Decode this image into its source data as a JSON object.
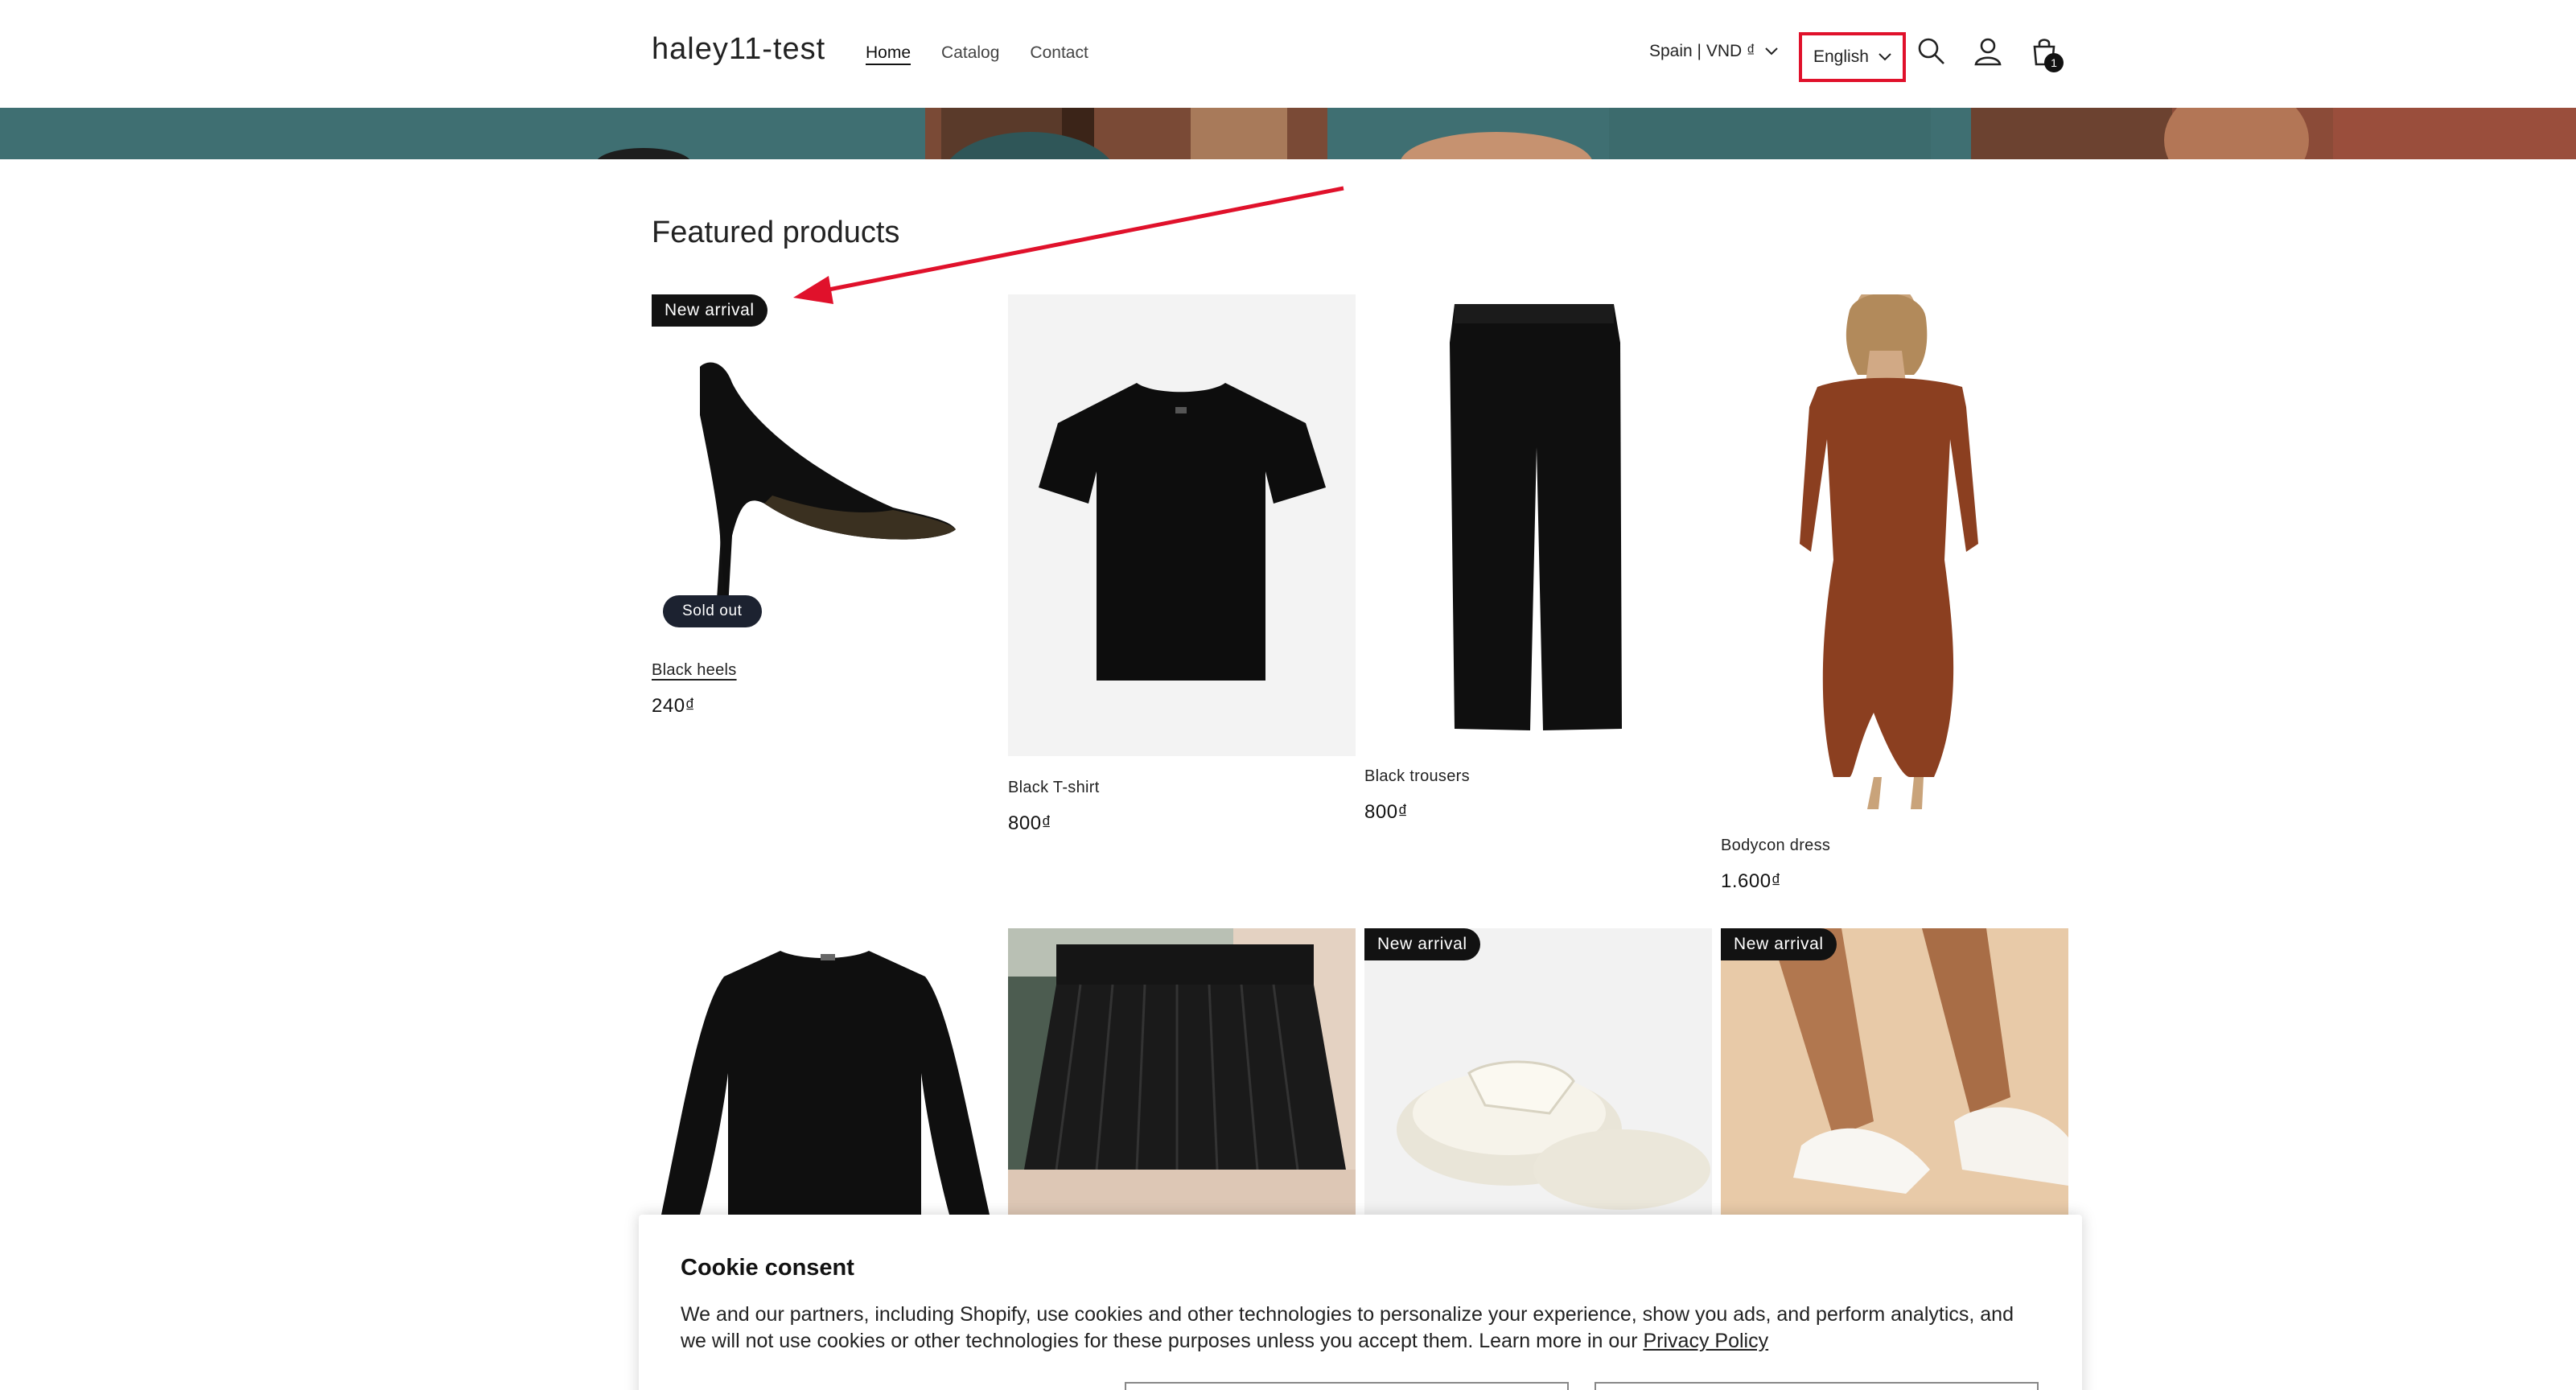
{
  "header": {
    "logo": "haley11-test",
    "nav": [
      {
        "label": "Home",
        "active": true
      },
      {
        "label": "Catalog",
        "active": false
      },
      {
        "label": "Contact",
        "active": false
      }
    ],
    "country_selector": "Spain | VND ₫",
    "language_selector": "English",
    "icons": [
      "search-icon",
      "account-icon",
      "cart-icon"
    ],
    "cart_count": "1",
    "highlight_color": "#e0112b"
  },
  "section": {
    "title": "Featured products"
  },
  "products": [
    {
      "title": "Black heels",
      "price": "240₫",
      "badge": "New arrival",
      "status_badge": "Sold out"
    },
    {
      "title": "Black T-shirt",
      "price": "800₫"
    },
    {
      "title": "Black trousers",
      "price": "800₫"
    },
    {
      "title": "Bodycon dress",
      "price": "1.600₫"
    },
    {
      "title": ""
    },
    {
      "title": ""
    },
    {
      "title": "",
      "badge": "New arrival"
    },
    {
      "title": "",
      "badge": "New arrival"
    }
  ],
  "cookie": {
    "title": "Cookie consent",
    "text": "We and our partners, including Shopify, use cookies and other technologies to personalize your experience, show you ads, and perform analytics, and we will not use cookies or other technologies for these purposes unless you accept them. Learn more in our",
    "link": "Privacy Policy"
  }
}
